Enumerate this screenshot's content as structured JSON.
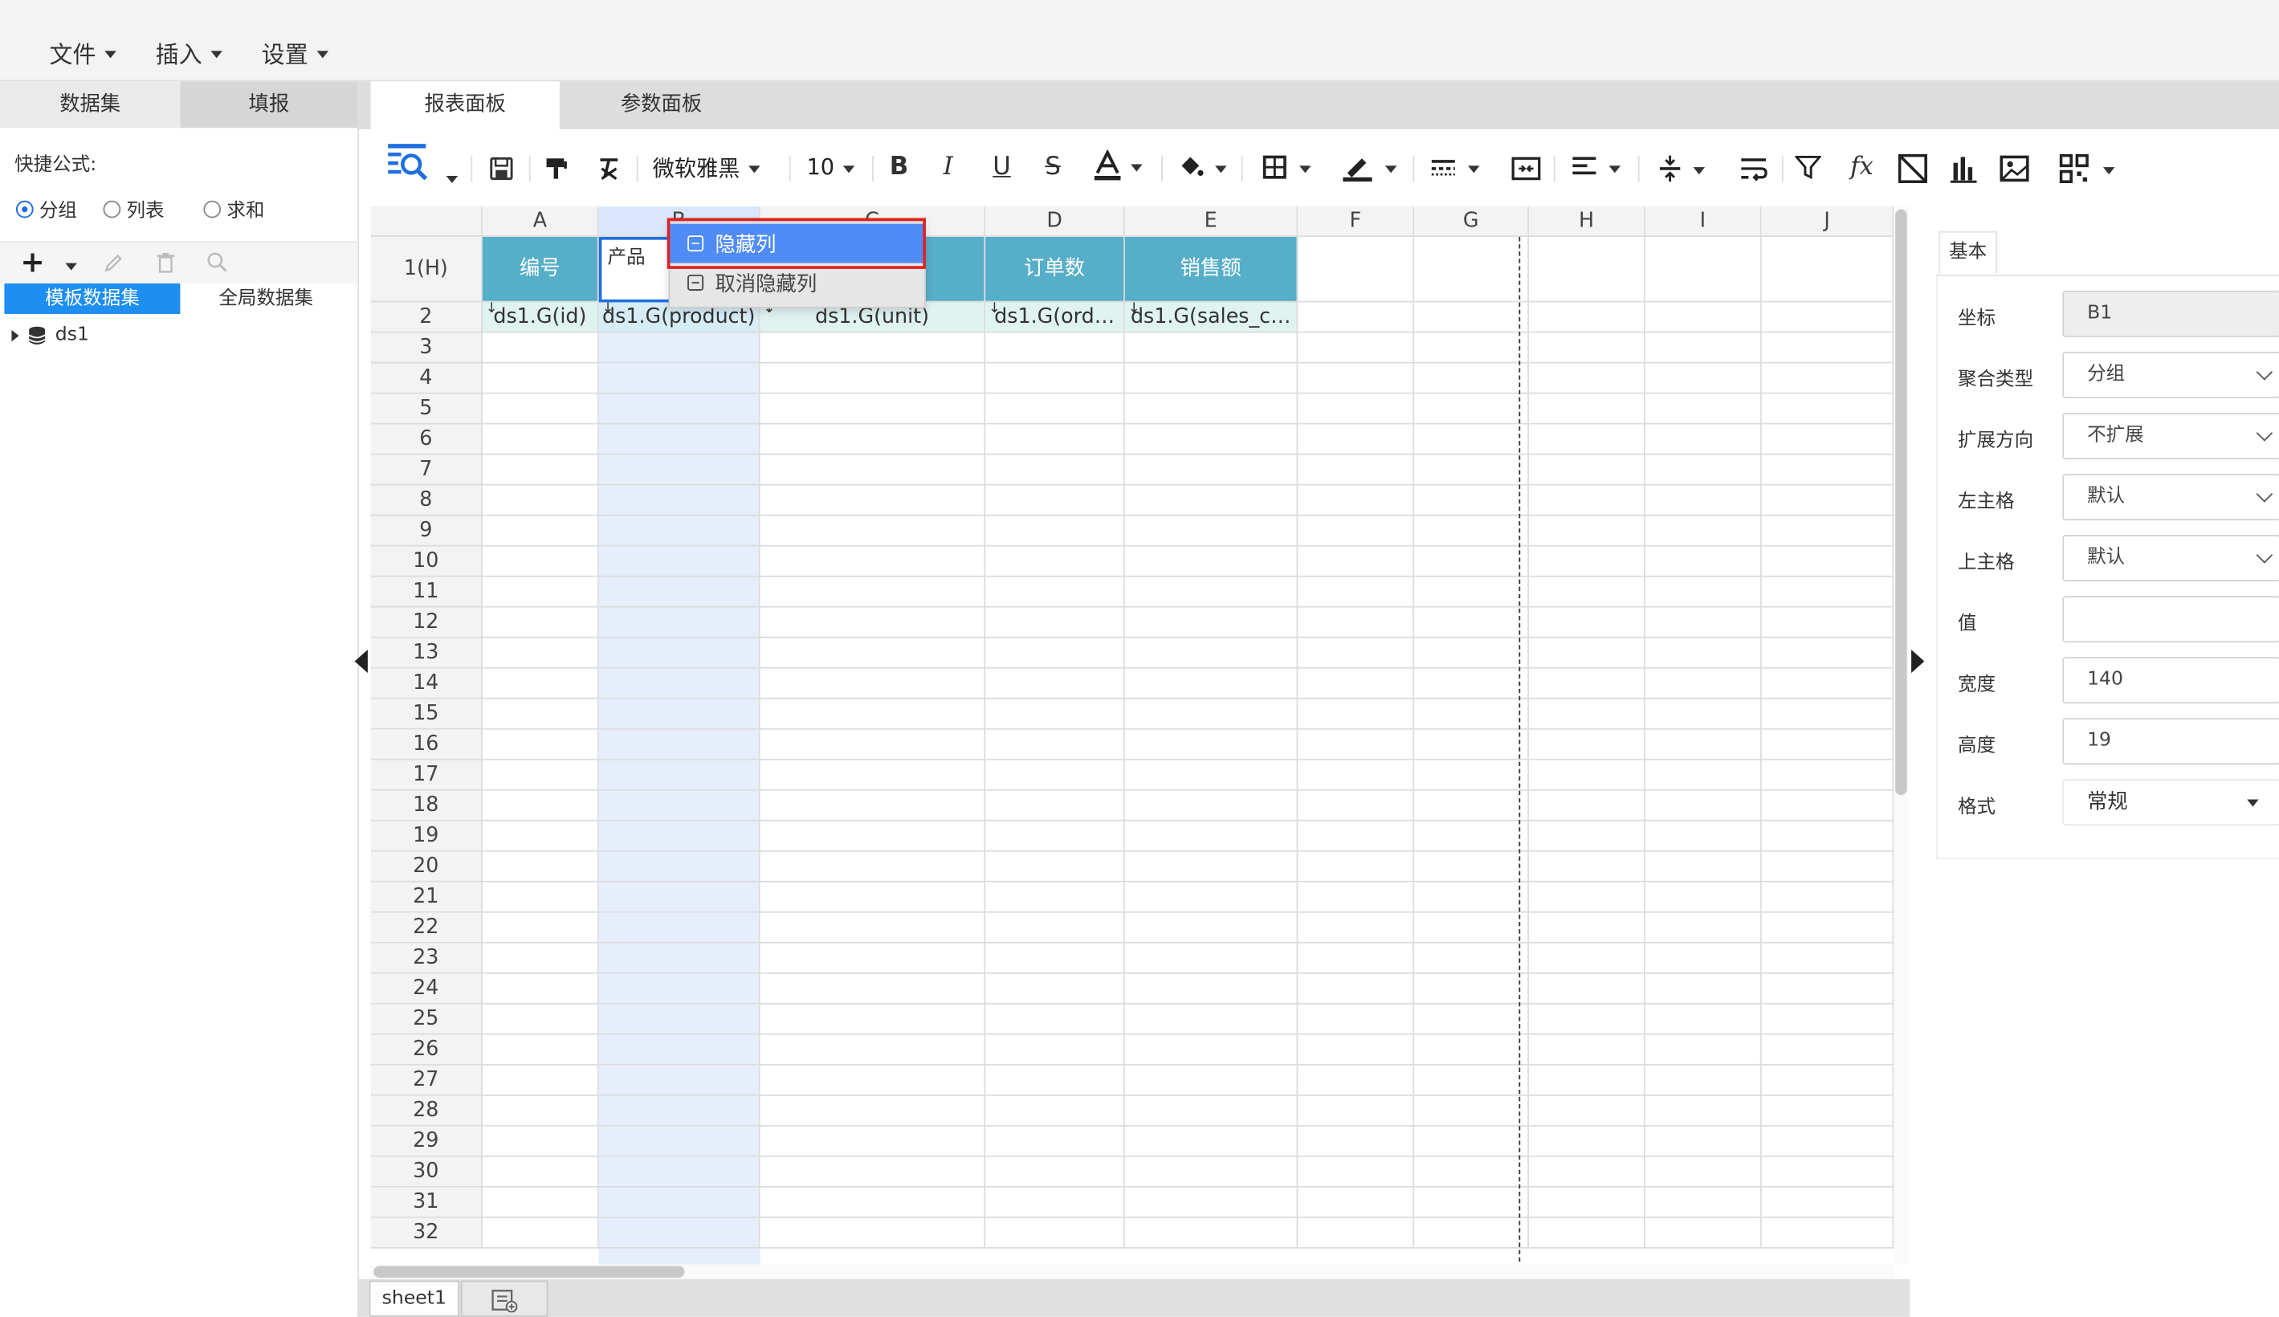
{
  "menubar": {
    "file": "文件",
    "insert": "插入",
    "settings": "设置"
  },
  "left_panel": {
    "tabs": [
      "数据集",
      "填报"
    ],
    "quick_formula_label": "快捷公式:",
    "radios": [
      {
        "label": "分组",
        "checked": true
      },
      {
        "label": "列表",
        "checked": false
      },
      {
        "label": "求和",
        "checked": false
      }
    ],
    "dataset_tabs": [
      "模板数据集",
      "全局数据集"
    ],
    "tree": [
      {
        "label": "ds1"
      }
    ]
  },
  "main_tabs": [
    "报表面板",
    "参数面板"
  ],
  "toolbar": {
    "font": "微软雅黑",
    "size": "10"
  },
  "grid": {
    "columns": [
      "A",
      "B",
      "C",
      "D",
      "E",
      "F",
      "G",
      "H",
      "I",
      "J"
    ],
    "row1_label": "1(H)",
    "header_row": [
      "编号",
      "产品",
      "",
      "订单数",
      "销售额"
    ],
    "formula_row": [
      "ds1.G(id)",
      "ds1.G(product)",
      "ds1.G(unit)",
      "ds1.G(ord…",
      "ds1.G(sales_c…"
    ],
    "row_numbers": [
      2,
      3,
      4,
      5,
      6,
      7,
      8,
      9,
      10,
      11,
      12,
      13,
      14,
      15,
      16,
      17,
      18,
      19,
      20,
      21,
      22,
      23,
      24,
      25,
      26,
      27,
      28,
      29,
      30,
      31,
      32
    ]
  },
  "context_menu": {
    "items": [
      "隐藏列",
      "取消隐藏列"
    ]
  },
  "right_panel": {
    "tab": "基本",
    "fields": [
      {
        "label": "坐标",
        "value": "B1",
        "type": "readonly"
      },
      {
        "label": "聚合类型",
        "value": "分组",
        "type": "select"
      },
      {
        "label": "扩展方向",
        "value": "不扩展",
        "type": "select"
      },
      {
        "label": "左主格",
        "value": "默认",
        "type": "select"
      },
      {
        "label": "上主格",
        "value": "默认",
        "type": "select"
      },
      {
        "label": "值",
        "value": "",
        "type": "input"
      },
      {
        "label": "宽度",
        "value": "140",
        "type": "input"
      },
      {
        "label": "高度",
        "value": "19",
        "type": "input"
      },
      {
        "label": "格式",
        "value": "常规",
        "type": "dropdown"
      }
    ]
  },
  "sheet_tabs": [
    "sheet1"
  ],
  "colors": {
    "accent": "#1e6fe0",
    "header_teal": "#57aec8",
    "menu_highlight": "#4f8cf5",
    "highlight_border": "#e02020"
  }
}
